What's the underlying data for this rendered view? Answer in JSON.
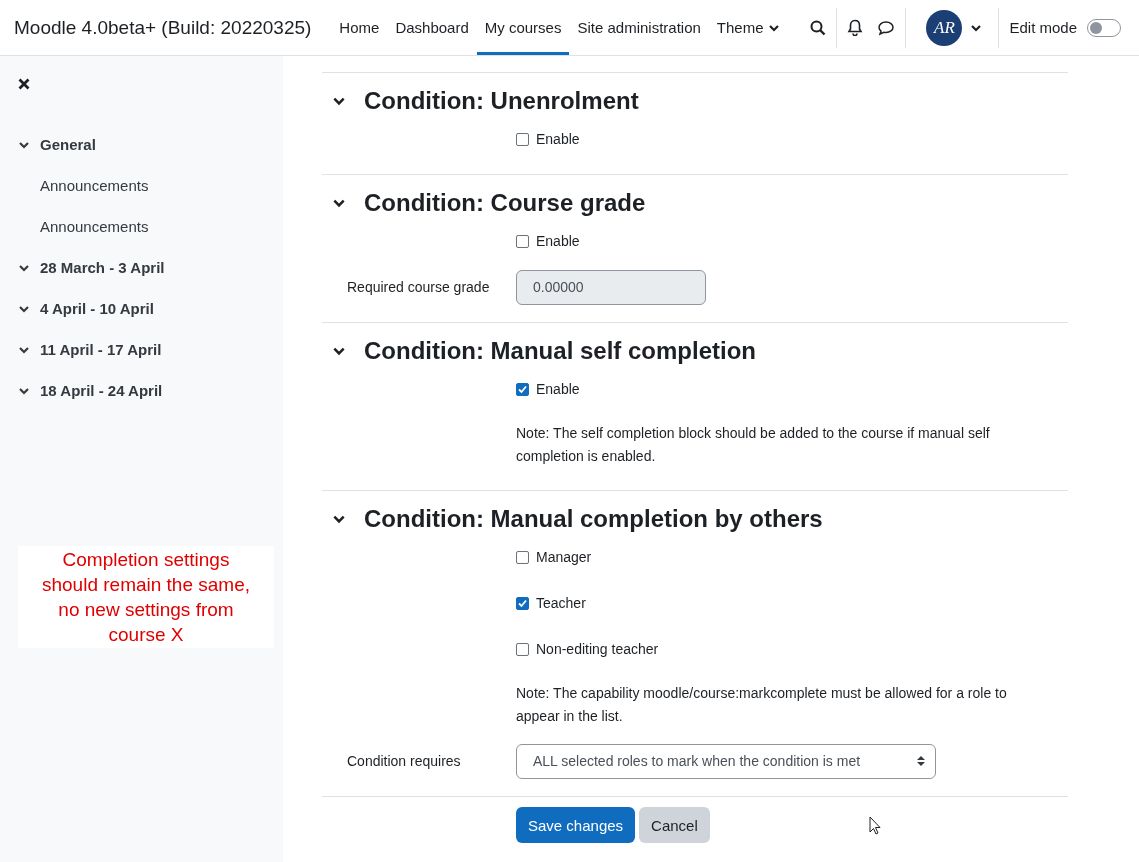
{
  "navbar": {
    "site_name": "Moodle 4.0beta+ (Build: 20220325)",
    "links": [
      {
        "label": "Home",
        "selected": false,
        "has_menu": false
      },
      {
        "label": "Dashboard",
        "selected": false,
        "has_menu": false
      },
      {
        "label": "My courses",
        "selected": true,
        "has_menu": false
      },
      {
        "label": "Site administration",
        "selected": false,
        "has_menu": false
      },
      {
        "label": "Theme",
        "selected": false,
        "has_menu": true
      }
    ],
    "avatar_initials": "AR",
    "edit_mode": {
      "label": "Edit mode",
      "on": false
    }
  },
  "sidebar": {
    "items": [
      {
        "label": "General",
        "kind": "section",
        "expanded": true,
        "children": [
          {
            "label": "Announcements"
          },
          {
            "label": "Announcements"
          }
        ]
      },
      {
        "label": "28 March - 3 April",
        "kind": "section",
        "expanded": true
      },
      {
        "label": "4 April - 10 April",
        "kind": "section",
        "expanded": true
      },
      {
        "label": "11 April - 17 April",
        "kind": "section",
        "expanded": true
      },
      {
        "label": "18 April - 24 April",
        "kind": "section",
        "expanded": true
      }
    ]
  },
  "annotation": "Completion settings should remain the same, no new settings from course X",
  "sections": [
    {
      "title": "Condition: Unenrolment",
      "expanded": true,
      "fields": [
        {
          "kind": "checkbox",
          "label": "Enable",
          "checked": false
        }
      ]
    },
    {
      "title": "Condition: Course grade",
      "expanded": true,
      "fields": [
        {
          "kind": "checkbox",
          "label": "Enable",
          "checked": false
        },
        {
          "kind": "text",
          "label": "Required course grade",
          "value": "0.00000",
          "disabled": true
        }
      ]
    },
    {
      "title": "Condition: Manual self completion",
      "expanded": true,
      "fields": [
        {
          "kind": "checkbox",
          "label": "Enable",
          "checked": true
        },
        {
          "kind": "note",
          "text": "Note: The self completion block should be added to the course if manual self completion is enabled."
        }
      ]
    },
    {
      "title": "Condition: Manual completion by others",
      "expanded": true,
      "fields": [
        {
          "kind": "checkbox",
          "label": "Manager",
          "checked": false
        },
        {
          "kind": "checkbox",
          "label": "Teacher",
          "checked": true
        },
        {
          "kind": "checkbox",
          "label": "Non-editing teacher",
          "checked": false
        },
        {
          "kind": "note",
          "text": "Note: The capability moodle/course:markcomplete must be allowed for a role to appear in the list."
        },
        {
          "kind": "select",
          "label": "Condition requires",
          "value": "ALL selected roles to mark when the condition is met"
        }
      ]
    }
  ],
  "buttons": [
    {
      "label": "Save changes",
      "kind": "primary"
    },
    {
      "label": "Cancel",
      "kind": "secondary"
    }
  ]
}
